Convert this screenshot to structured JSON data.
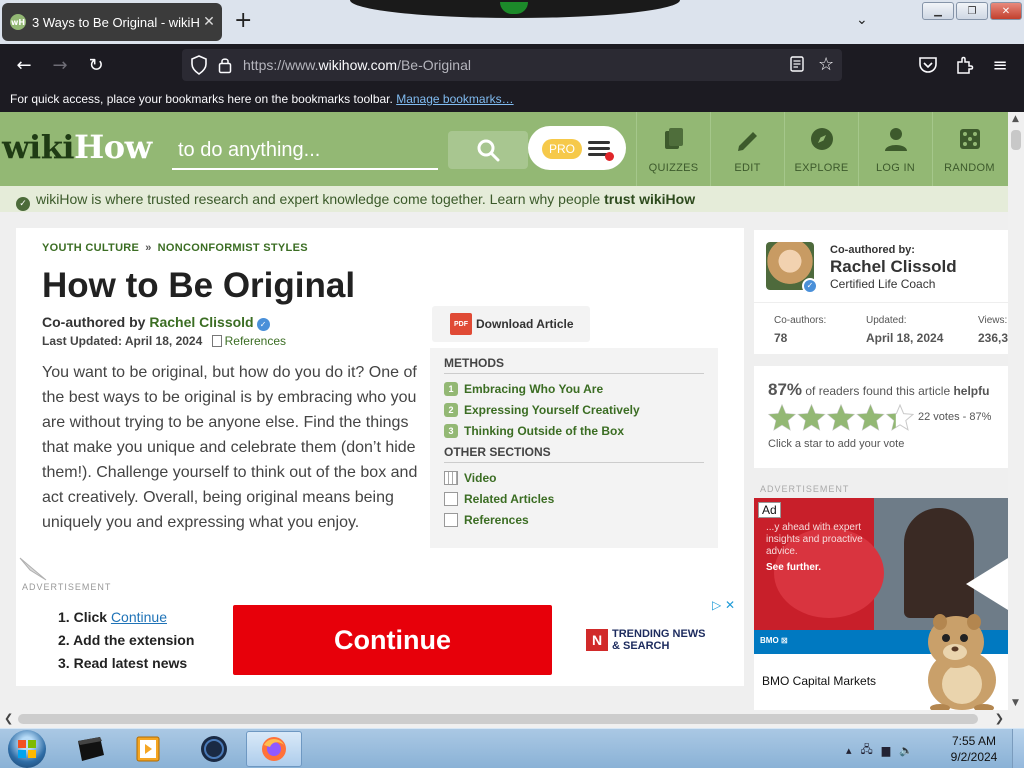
{
  "browser": {
    "tab_title": "3 Ways to Be Original - wikiHow",
    "tab_close": "✕",
    "new_tab": "+",
    "tab_list": "⌄",
    "window_buttons": {
      "minimize": "▁",
      "maximize": "❐",
      "close": "✕"
    },
    "nav": {
      "back": "←",
      "forward": "→",
      "reload": "↻"
    },
    "url_prefix": "https://www.",
    "url_domain": "wikihow.com",
    "url_path": "/Be-Original",
    "bookmarks_text": "For quick access, place your bookmarks here on the bookmarks toolbar.",
    "manage_bookmarks": "Manage bookmarks…",
    "star": "☆",
    "menu": "≡"
  },
  "wikihow": {
    "logo_wiki": "wiki",
    "logo_how": "How",
    "search_placeholder": "to do anything...",
    "pro_label": "PRO",
    "nav": [
      {
        "label": "QUIZZES",
        "icon": "quizzes-icon"
      },
      {
        "label": "EDIT",
        "icon": "pencil-icon"
      },
      {
        "label": "EXPLORE",
        "icon": "compass-icon"
      },
      {
        "label": "LOG IN",
        "icon": "user-icon"
      },
      {
        "label": "RANDOM",
        "icon": "dice-icon"
      }
    ],
    "trust_text": "wikiHow is where trusted research and expert knowledge come together. Learn why people",
    "trust_link": "trust wikiHow"
  },
  "article": {
    "breadcrumb": [
      "YOUTH CULTURE",
      "NONCONFORMIST STYLES"
    ],
    "breadcrumb_sep": "»",
    "title": "How to Be Original",
    "coauthored_prefix": "Co-authored by",
    "coauthor": "Rachel Clissold",
    "last_updated": "Last Updated: April 18, 2024",
    "references_label": "References",
    "intro": "You want to be original, but how do you do it? One of the best ways to be original is by embracing who you are without trying to be anyone else. Find the things that make you unique and celebrate them (don’t hide them!). Challenge yourself to think out of the box and act creatively. Overall, being original means being uniquely you and expressing what you enjoy.",
    "download_label": "Download Article",
    "pdf_label": "PDF",
    "toc": {
      "methods_header": "METHODS",
      "methods": [
        {
          "num": "1",
          "label": "Embracing Who You Are"
        },
        {
          "num": "2",
          "label": "Expressing Yourself Creatively"
        },
        {
          "num": "3",
          "label": "Thinking Outside of the Box"
        }
      ],
      "other_header": "OTHER SECTIONS",
      "other": [
        "Video",
        "Related Articles",
        "References"
      ]
    }
  },
  "ad_bottom": {
    "label": "ADVERTISEMENT",
    "steps": [
      {
        "num": "1.",
        "text": "Click",
        "link": "Continue"
      },
      {
        "num": "2.",
        "text": "Add the extension",
        "link": ""
      },
      {
        "num": "3.",
        "text": "Read latest news",
        "link": ""
      }
    ],
    "button": "Continue",
    "brand_line1": "TRENDING NEWS",
    "brand_line2": "& SEARCH",
    "brand_logo": "N",
    "choice": "▷ ✕"
  },
  "author_card": {
    "label": "Co-authored by:",
    "name": "Rachel Clissold",
    "credential": "Certified Life Coach",
    "stats": [
      {
        "label": "Co-authors:",
        "value": "78"
      },
      {
        "label": "Updated:",
        "value": "April 18, 2024"
      },
      {
        "label": "Views:",
        "value": "236,3"
      }
    ]
  },
  "rating_card": {
    "percent": "87%",
    "text": "of readers found this article",
    "bold": "helpfu",
    "stars": 4.35,
    "votes": "22 votes - 87%",
    "hint": "Click a star to add your vote",
    "star_color": "#93b874"
  },
  "ad_side": {
    "label": "ADVERTISEMENT",
    "tag": "Ad",
    "copy": "...y ahead with expert insights and proactive advice.",
    "see_further": "See further.",
    "bmo_logo": "BMO ⊠",
    "advertiser": "BMO Capital Markets"
  },
  "taskbar": {
    "time": "7:55 AM",
    "date": "9/2/2024"
  }
}
